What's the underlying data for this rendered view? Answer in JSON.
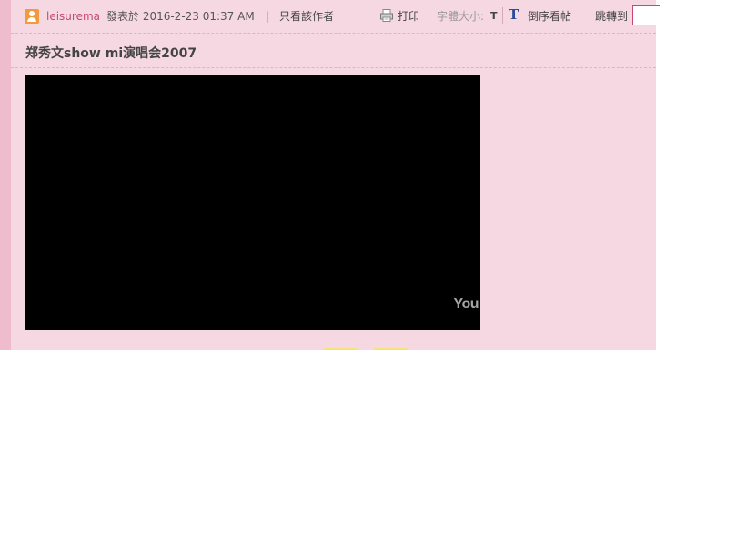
{
  "post": {
    "author": "leisurema",
    "time_text": "發表於 2016-2-23 01:37 AM",
    "separator": "|",
    "author_only_label": "只看該作者",
    "title": "郑秀文show mi演唱会2007"
  },
  "toolbar": {
    "print_label": "打印",
    "font_size_label": "字體大小:",
    "font_size_t": "T",
    "big_t": "T",
    "reverse_label": "倒序看帖",
    "jump_label": "跳轉到"
  },
  "video": {
    "watermark": "You"
  },
  "colors": {
    "panel_bg": "#f5d8e2",
    "left_bar": "#efbccd",
    "author_link": "#c54a6d",
    "big_t": "#2a4a9a"
  },
  "icons": {
    "user": "user-avatar-icon",
    "print": "printer-icon"
  }
}
